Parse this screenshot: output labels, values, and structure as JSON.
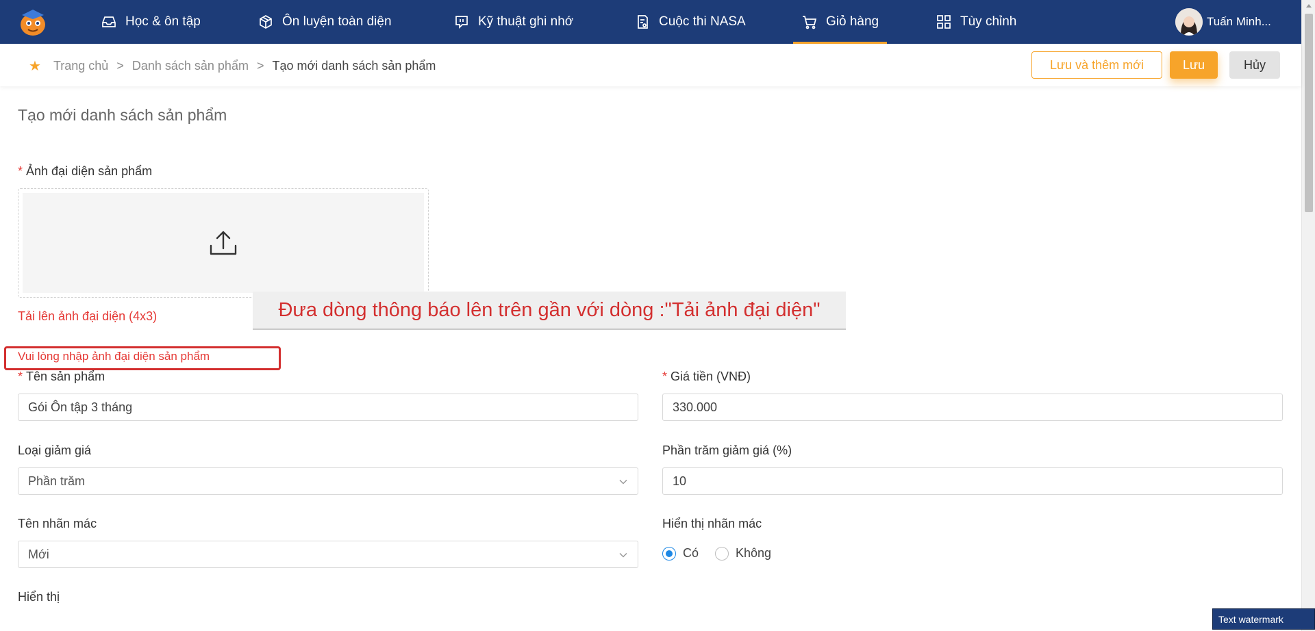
{
  "nav": {
    "items": [
      {
        "label": "Học & ôn tập",
        "icon": "inbox-icon"
      },
      {
        "label": "Ôn luyện toàn diện",
        "icon": "cube-icon"
      },
      {
        "label": "Kỹ thuật ghi nhớ",
        "icon": "message-icon"
      },
      {
        "label": "Cuộc thi NASA",
        "icon": "document-icon"
      },
      {
        "label": "Giỏ hàng",
        "icon": "cart-icon",
        "active": true
      },
      {
        "label": "Tùy chỉnh",
        "icon": "grid-icon"
      }
    ],
    "user_name": "Tuấn Minh..."
  },
  "breadcrumb": {
    "items": [
      "Trang chủ",
      "Danh sách sản phẩm",
      "Tạo mới danh sách sản phẩm"
    ],
    "separator": ">"
  },
  "actions": {
    "save_and_new": "Lưu và thêm mới",
    "save": "Lưu",
    "cancel": "Hủy"
  },
  "page_title": "Tạo mới danh sách sản phẩm",
  "form": {
    "image": {
      "label": "Ảnh đại diện sản phẩm",
      "required": "*",
      "hint": "Tải lên ảnh đại diện (4x3)",
      "error": "Vui lòng nhập ảnh đại diện sản phẩm"
    },
    "name": {
      "label": "Tên sản phẩm",
      "required": "*",
      "value": "Gói Ôn tập 3 tháng"
    },
    "price": {
      "label": "Giá tiền (VNĐ)",
      "required": "*",
      "value": "330.000"
    },
    "discount_type": {
      "label": "Loại giảm giá",
      "value": "Phần trăm"
    },
    "discount_percent": {
      "label": "Phần trăm giảm giá (%)",
      "value": "10"
    },
    "tag_name": {
      "label": "Tên nhãn mác",
      "value": "Mới"
    },
    "tag_display": {
      "label": "Hiển thị nhãn mác",
      "options": [
        "Có",
        "Không"
      ],
      "selected": "Có"
    },
    "display": {
      "label": "Hiển thị"
    }
  },
  "annotation": "Đưa dòng thông báo lên trên gần với dòng :\"Tải ảnh đại diện\"",
  "watermark": "Text watermark",
  "colors": {
    "nav_bg": "#1d3c78",
    "accent": "#f7a42a",
    "error": "#e53935",
    "radio": "#1e88e5"
  }
}
